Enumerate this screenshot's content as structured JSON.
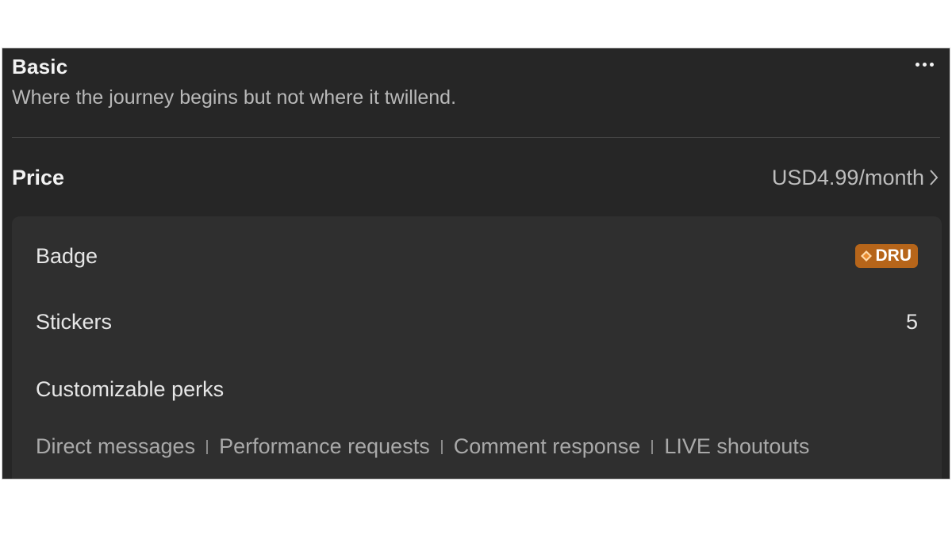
{
  "tier": {
    "title": "Basic",
    "subtitle": "Where the journey begins but not where it twillend."
  },
  "price": {
    "label": "Price",
    "value": "USD4.99/month"
  },
  "perks": {
    "badge_label": "Badge",
    "badge_text": "DRU",
    "badge_color": "#b6651a",
    "stickers_label": "Stickers",
    "stickers_value": "5",
    "customizable_label": "Customizable perks",
    "customizable_items": [
      "Direct messages",
      "Performance requests",
      "Comment response",
      "LIVE shoutouts"
    ]
  },
  "icons": {
    "more": "more-horizontal-icon",
    "chevron": "chevron-right-icon",
    "badge": "diamond-icon"
  }
}
